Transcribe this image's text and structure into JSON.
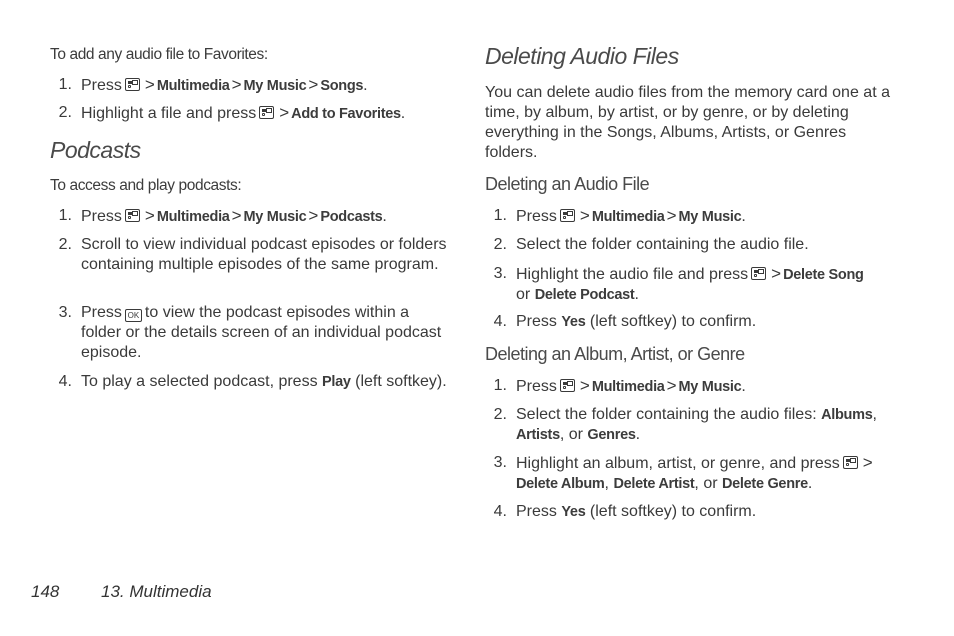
{
  "left": {
    "favorites_intro": "To add any audio file to Favorites:",
    "favorites_steps": [
      {
        "num": "1.",
        "pre": "Press",
        "path": [
          "Multimedia",
          "My Music",
          "Songs"
        ],
        "post": "."
      },
      {
        "num": "2.",
        "pre": "Highlight a file and press",
        "path": [
          "Add to Favorites"
        ],
        "post": "."
      }
    ],
    "podcasts_heading": "Podcasts",
    "podcasts_intro": "To access and play podcasts:",
    "podcasts_steps": [
      {
        "num": "1.",
        "pre": "Press",
        "path": [
          "Multimedia",
          "My Music",
          "Podcasts"
        ],
        "post": "."
      },
      {
        "num": "2.",
        "text": "Scroll to view individual podcast episodes or folders containing multiple episodes of the same program."
      },
      {
        "num": "3.",
        "pre": "Press",
        "key": "OK",
        "post": "to view the podcast episodes within a folder or the details screen of an individual podcast episode."
      },
      {
        "num": "4.",
        "pre": "To play a selected podcast, press",
        "bold": "Play",
        "post": "(left softkey)."
      }
    ]
  },
  "right": {
    "heading": "Deleting Audio Files",
    "intro": "You can delete audio files from the memory card one at a time, by album, by artist, or by genre, or by deleting everything in the Songs, Albums, Artists, or Genres folders.",
    "file_subheading": "Deleting an Audio File",
    "file_steps": [
      {
        "num": "1.",
        "pre": "Press",
        "path": [
          "Multimedia",
          "My Music"
        ],
        "post": "."
      },
      {
        "num": "2.",
        "text": "Select the folder containing the audio file."
      },
      {
        "num": "3.",
        "pre": "Highlight the audio file and press",
        "path": [
          "Delete Song"
        ],
        "mid": "or",
        "bold2": "Delete Podcast",
        "post": "."
      },
      {
        "num": "4.",
        "pre": "Press",
        "bold": "Yes",
        "post": "(left softkey) to confirm."
      }
    ],
    "album_subheading": "Deleting an Album, Artist, or Genre",
    "album_steps": [
      {
        "num": "1.",
        "pre": "Press",
        "path": [
          "Multimedia",
          "My Music"
        ],
        "post": "."
      },
      {
        "num": "2.",
        "pre": "Select the folder containing the audio files:",
        "bold_a": "Albums",
        "bold_b": "Artists",
        "mid": ", or",
        "bold_c": "Genres",
        "post": "."
      },
      {
        "num": "3.",
        "pre": "Highlight an album, artist, or genre, and press",
        "bold_a": "Delete Album",
        "bold_b": "Delete Artist",
        "mid": ", or",
        "bold_c": "Delete Genre",
        "post": "."
      },
      {
        "num": "4.",
        "pre": "Press",
        "bold": "Yes",
        "post": "(left softkey) to confirm."
      }
    ]
  },
  "footer": {
    "page_number": "148",
    "section": "13. Multimedia"
  },
  "symbols": {
    "gt": ">",
    "comma": ",",
    "menu_icon": "menu-key-icon",
    "ok_icon": "ok-key-icon"
  }
}
